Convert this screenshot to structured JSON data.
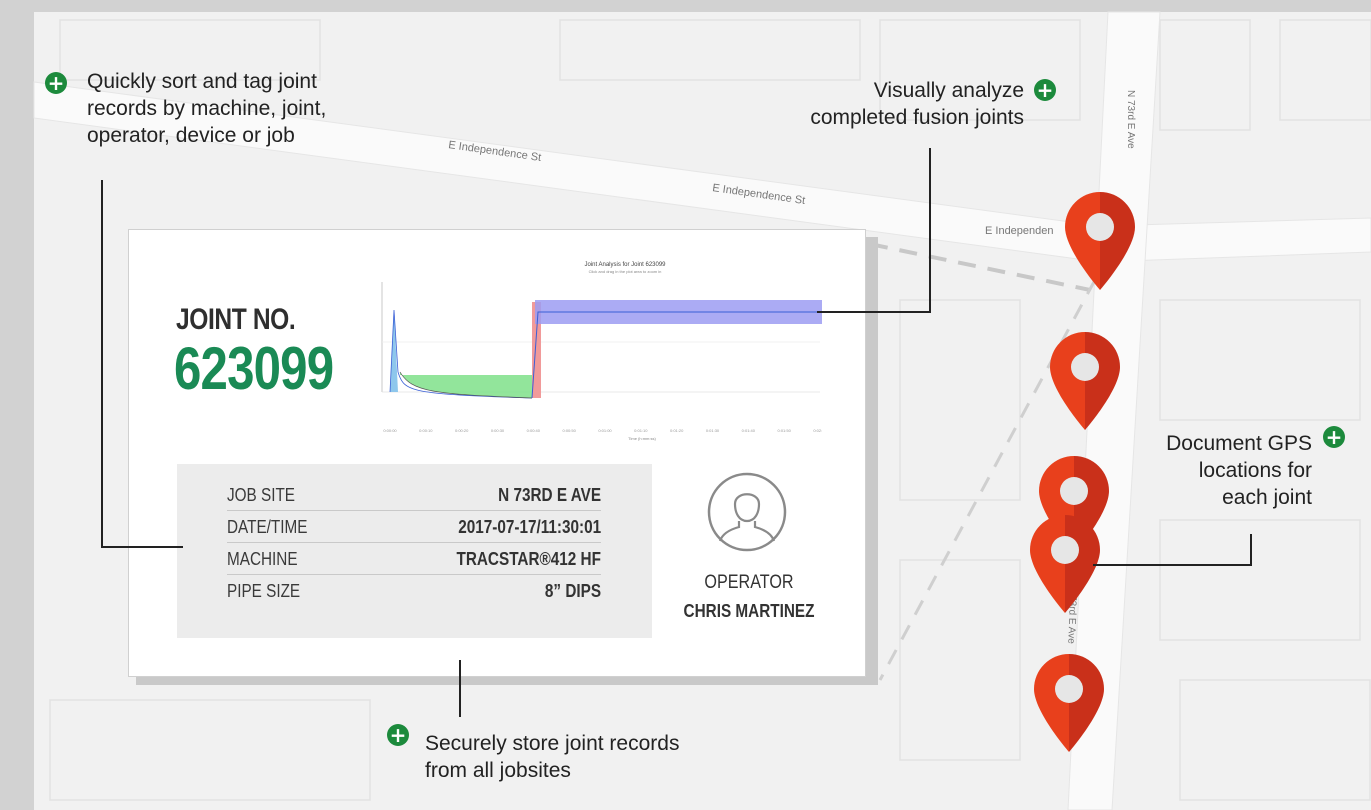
{
  "callouts": {
    "sort": [
      "Quickly sort and tag joint",
      "records by machine, joint,",
      "operator, device or job"
    ],
    "analyze": [
      "Visually analyze",
      "completed fusion joints"
    ],
    "gps": [
      "Document GPS",
      "locations for",
      "each joint"
    ],
    "store": [
      "Securely store joint records",
      "from all jobsites"
    ]
  },
  "map_labels": {
    "street1": "E Independence St",
    "street2": "E Independence St",
    "street3": "E Independen",
    "avenue1": "N 73rd E Ave",
    "avenue2": "73rd E Ave"
  },
  "card": {
    "joint_label": "JOINT NO.",
    "joint_number": "623099",
    "info": [
      {
        "label": "JOB SITE",
        "value": "N 73RD E AVE"
      },
      {
        "label": "DATE/TIME",
        "value": "2017-07-17/11:30:01"
      },
      {
        "label": "MACHINE",
        "value": "TRACSTAR®412 HF"
      },
      {
        "label": "PIPE SIZE",
        "value": "8” DIPS"
      }
    ],
    "operator_label": "OPERATOR",
    "operator_name": "CHRIS MARTINEZ"
  },
  "chart_data": {
    "type": "line",
    "title": "Joint Analysis for Joint 623099",
    "subtitle": "Click and drag in the plot area to zoom in",
    "xlabel": "Time (h:mm:ss)",
    "ylabel": "",
    "x_ticks": [
      "0:00:00",
      "0:00:10",
      "0:00:20",
      "0:00:30",
      "0:00:40",
      "0:00:50",
      "0:01:00",
      "0:01:10",
      "0:01:20",
      "0:01:30",
      "0:01:40",
      "0:01:50",
      "0:02:00"
    ],
    "colors": {
      "spike": "#8ec7ec",
      "heat": "#7fe08a",
      "transition": "#f19a9a",
      "cool": "#9c9cf2",
      "line": "#3a5fd6"
    }
  },
  "colors": {
    "accent_green": "#1c8a3c",
    "joint_green": "#1a8a55",
    "pin_red": "#e8401c",
    "pin_dark": "#c9301a"
  }
}
